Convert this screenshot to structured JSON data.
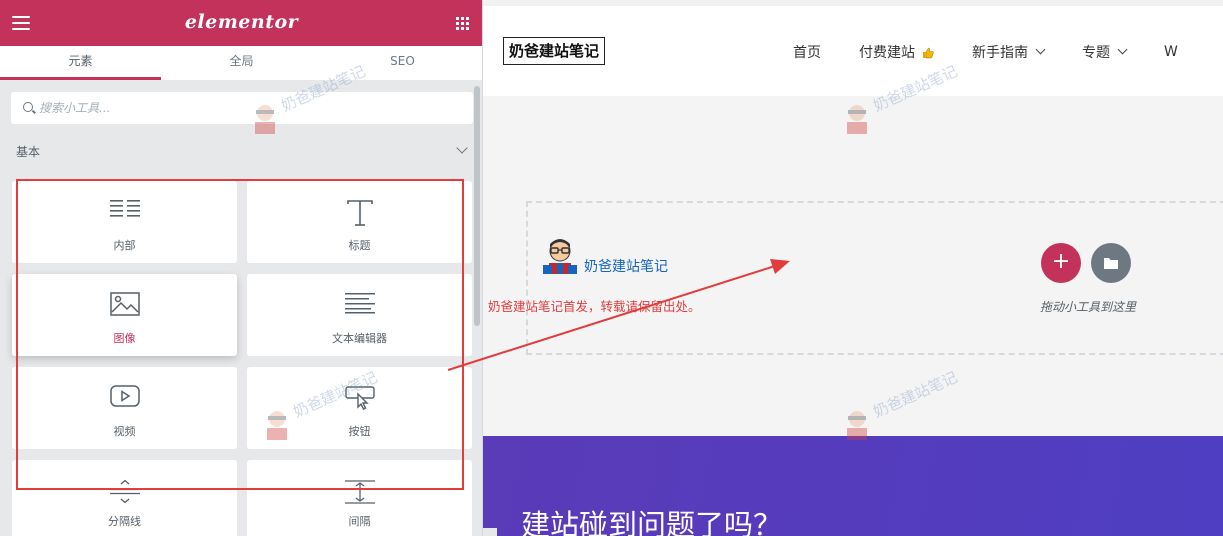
{
  "panel": {
    "brand": "elementor",
    "tabs": [
      "元素",
      "全局",
      "SEO"
    ],
    "search_placeholder": "搜索小工具...",
    "category": "基本",
    "widgets": [
      "内部",
      "标题",
      "图像",
      "文本编辑器",
      "视频",
      "按钮",
      "分隔线",
      "间隔"
    ]
  },
  "preview": {
    "site_title": "奶爸建站笔记",
    "nav": [
      {
        "label": "首页"
      },
      {
        "label": "付费建站"
      },
      {
        "label": "新手指南"
      },
      {
        "label": "专题"
      },
      {
        "label": "W"
      }
    ],
    "author_name": "奶爸建站笔记",
    "reprint_note": "奶爸建站笔记首发，转载请保留出处。",
    "add_button_symbol": "+",
    "drop_hint": "拖动小工具到这里",
    "hero_title": "建站碰到问题了吗？"
  },
  "watermark_text": "奶爸建站笔记",
  "colors": {
    "brand": "#c2325a",
    "panel_bg": "#e6e8ea",
    "annotation": "#e23c3c",
    "hero": "#5a3bb8",
    "link": "#1565c0"
  },
  "icons": [
    "menu-icon",
    "apps-grid-icon",
    "search-icon",
    "chevron-down-icon",
    "inner-section-icon",
    "heading-icon",
    "image-icon",
    "text-editor-icon",
    "video-icon",
    "button-icon",
    "divider-icon",
    "spacer-icon",
    "thumbs-up-icon",
    "plus-icon",
    "folder-icon"
  ]
}
